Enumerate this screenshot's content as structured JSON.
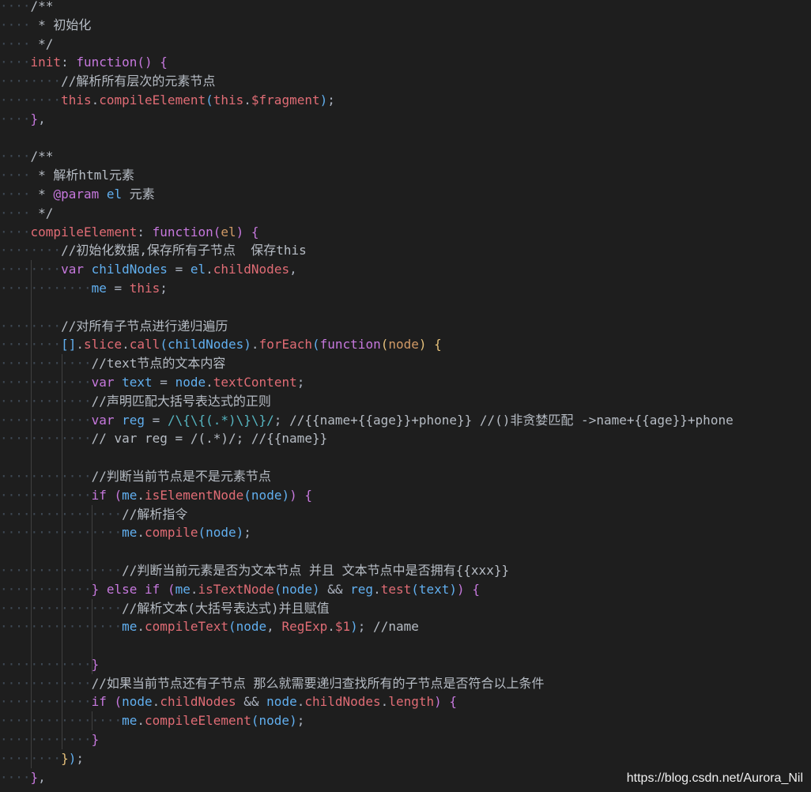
{
  "theme": {
    "background": "#1e1e1e",
    "comment": "#b6bcc4",
    "keyword": "#c678dd",
    "property": "#e06c75",
    "variable": "#61afef",
    "regex": "#56b6c2",
    "param": "#d19a66",
    "bracket_1": "#e5c07b",
    "bracket_2": "#c678dd",
    "bracket_3": "#61afef",
    "punct": "#abb2bf",
    "text": "#d7dae0",
    "indent_dots": "#3f4a56",
    "guide": "#404040"
  },
  "code_lines": [
    {
      "d": 1,
      "t": [
        [
          "/**",
          "comment"
        ]
      ]
    },
    {
      "d": 1,
      "t": [
        [
          " * 初始化",
          "comment"
        ]
      ]
    },
    {
      "d": 1,
      "t": [
        [
          " */",
          "comment"
        ]
      ]
    },
    {
      "d": 1,
      "t": [
        [
          "init",
          "property"
        ],
        [
          ": ",
          "punct"
        ],
        [
          "function",
          "keyword"
        ],
        [
          "()",
          "bracket_2"
        ],
        [
          " ",
          "text"
        ],
        [
          "{",
          "bracket_2"
        ]
      ]
    },
    {
      "d": 2,
      "t": [
        [
          "//解析所有层次的元素节点",
          "comment"
        ]
      ]
    },
    {
      "d": 2,
      "t": [
        [
          "this",
          "property"
        ],
        [
          ".",
          "punct"
        ],
        [
          "compileElement",
          "property"
        ],
        [
          "(",
          "bracket_3"
        ],
        [
          "this",
          "property"
        ],
        [
          ".",
          "punct"
        ],
        [
          "$fragment",
          "property"
        ],
        [
          ")",
          "bracket_3"
        ],
        [
          ";",
          "punct"
        ]
      ]
    },
    {
      "d": 1,
      "t": [
        [
          "}",
          "bracket_2"
        ],
        [
          ",",
          "punct"
        ]
      ]
    },
    {
      "d": 0,
      "t": []
    },
    {
      "d": 1,
      "t": [
        [
          "/**",
          "comment"
        ]
      ]
    },
    {
      "d": 1,
      "t": [
        [
          " * 解析html元素",
          "comment"
        ]
      ]
    },
    {
      "d": 1,
      "t": [
        [
          " * ",
          "comment"
        ],
        [
          "@param",
          "keyword"
        ],
        [
          " el",
          "variable"
        ],
        [
          " 元素",
          "comment"
        ]
      ]
    },
    {
      "d": 1,
      "t": [
        [
          " */",
          "comment"
        ]
      ]
    },
    {
      "d": 1,
      "t": [
        [
          "compileElement",
          "property"
        ],
        [
          ": ",
          "punct"
        ],
        [
          "function",
          "keyword"
        ],
        [
          "(",
          "bracket_2"
        ],
        [
          "el",
          "param"
        ],
        [
          ")",
          "bracket_2"
        ],
        [
          " ",
          "text"
        ],
        [
          "{",
          "bracket_2"
        ]
      ]
    },
    {
      "d": 2,
      "t": [
        [
          "//初始化数据,保存所有子节点  保存this",
          "comment"
        ]
      ]
    },
    {
      "d": 2,
      "t": [
        [
          "var",
          "keyword"
        ],
        [
          " childNodes",
          "variable"
        ],
        [
          " = ",
          "punct"
        ],
        [
          "el",
          "variable"
        ],
        [
          ".",
          "punct"
        ],
        [
          "childNodes",
          "property"
        ],
        [
          ",",
          "punct"
        ]
      ]
    },
    {
      "d": 3,
      "t": [
        [
          "me",
          "variable"
        ],
        [
          " = ",
          "punct"
        ],
        [
          "this",
          "property"
        ],
        [
          ";",
          "punct"
        ]
      ]
    },
    {
      "d": 0,
      "t": []
    },
    {
      "d": 2,
      "t": [
        [
          "//对所有子节点进行递归遍历",
          "comment"
        ]
      ]
    },
    {
      "d": 2,
      "t": [
        [
          "[]",
          "bracket_3"
        ],
        [
          ".",
          "punct"
        ],
        [
          "slice",
          "property"
        ],
        [
          ".",
          "punct"
        ],
        [
          "call",
          "property"
        ],
        [
          "(",
          "bracket_3"
        ],
        [
          "childNodes",
          "variable"
        ],
        [
          ")",
          "bracket_3"
        ],
        [
          ".",
          "punct"
        ],
        [
          "forEach",
          "property"
        ],
        [
          "(",
          "bracket_3"
        ],
        [
          "function",
          "keyword"
        ],
        [
          "(",
          "bracket_1"
        ],
        [
          "node",
          "param"
        ],
        [
          ")",
          "bracket_1"
        ],
        [
          " ",
          "text"
        ],
        [
          "{",
          "bracket_1"
        ]
      ]
    },
    {
      "d": 3,
      "t": [
        [
          "//text节点的文本内容",
          "comment"
        ]
      ]
    },
    {
      "d": 3,
      "t": [
        [
          "var",
          "keyword"
        ],
        [
          " text",
          "variable"
        ],
        [
          " = ",
          "punct"
        ],
        [
          "node",
          "variable"
        ],
        [
          ".",
          "punct"
        ],
        [
          "textContent",
          "property"
        ],
        [
          ";",
          "punct"
        ]
      ]
    },
    {
      "d": 3,
      "t": [
        [
          "//声明匹配大括号表达式的正则",
          "comment"
        ]
      ]
    },
    {
      "d": 3,
      "t": [
        [
          "var",
          "keyword"
        ],
        [
          " reg",
          "variable"
        ],
        [
          " = ",
          "punct"
        ],
        [
          "/\\{\\{(.*)\\}\\}/",
          "regex"
        ],
        [
          ";",
          "punct"
        ],
        [
          " //{{name+{{age}}+phone}} //()非贪婪匹配 ->name+{{age}}+phone",
          "comment"
        ]
      ]
    },
    {
      "d": 3,
      "t": [
        [
          "// var reg = /(.*)/; //{{name}}",
          "comment"
        ]
      ]
    },
    {
      "d": 0,
      "t": []
    },
    {
      "d": 3,
      "t": [
        [
          "//判断当前节点是不是元素节点",
          "comment"
        ]
      ]
    },
    {
      "d": 3,
      "t": [
        [
          "if",
          "keyword"
        ],
        [
          " ",
          "text"
        ],
        [
          "(",
          "bracket_2"
        ],
        [
          "me",
          "variable"
        ],
        [
          ".",
          "punct"
        ],
        [
          "isElementNode",
          "property"
        ],
        [
          "(",
          "bracket_3"
        ],
        [
          "node",
          "variable"
        ],
        [
          ")",
          "bracket_3"
        ],
        [
          ")",
          "bracket_2"
        ],
        [
          " ",
          "text"
        ],
        [
          "{",
          "bracket_2"
        ]
      ]
    },
    {
      "d": 4,
      "t": [
        [
          "//解析指令",
          "comment"
        ]
      ]
    },
    {
      "d": 4,
      "t": [
        [
          "me",
          "variable"
        ],
        [
          ".",
          "punct"
        ],
        [
          "compile",
          "property"
        ],
        [
          "(",
          "bracket_3"
        ],
        [
          "node",
          "variable"
        ],
        [
          ")",
          "bracket_3"
        ],
        [
          ";",
          "punct"
        ]
      ]
    },
    {
      "d": 0,
      "t": []
    },
    {
      "d": 4,
      "t": [
        [
          "//判断当前元素是否为文本节点 并且 文本节点中是否拥有{{xxx}}",
          "comment"
        ]
      ]
    },
    {
      "d": 3,
      "t": [
        [
          "}",
          "bracket_2"
        ],
        [
          " else if ",
          "keyword"
        ],
        [
          "(",
          "bracket_2"
        ],
        [
          "me",
          "variable"
        ],
        [
          ".",
          "punct"
        ],
        [
          "isTextNode",
          "property"
        ],
        [
          "(",
          "bracket_3"
        ],
        [
          "node",
          "variable"
        ],
        [
          ")",
          "bracket_3"
        ],
        [
          " && ",
          "punct"
        ],
        [
          "reg",
          "variable"
        ],
        [
          ".",
          "punct"
        ],
        [
          "test",
          "property"
        ],
        [
          "(",
          "bracket_3"
        ],
        [
          "text",
          "variable"
        ],
        [
          ")",
          "bracket_3"
        ],
        [
          ")",
          "bracket_2"
        ],
        [
          " ",
          "text"
        ],
        [
          "{",
          "bracket_2"
        ]
      ]
    },
    {
      "d": 4,
      "t": [
        [
          "//解析文本(大括号表达式)并且赋值",
          "comment"
        ]
      ]
    },
    {
      "d": 4,
      "t": [
        [
          "me",
          "variable"
        ],
        [
          ".",
          "punct"
        ],
        [
          "compileText",
          "property"
        ],
        [
          "(",
          "bracket_3"
        ],
        [
          "node",
          "variable"
        ],
        [
          ", ",
          "punct"
        ],
        [
          "RegExp",
          "property"
        ],
        [
          ".",
          "punct"
        ],
        [
          "$1",
          "property"
        ],
        [
          ")",
          "bracket_3"
        ],
        [
          ";",
          "punct"
        ],
        [
          " //name",
          "comment"
        ]
      ]
    },
    {
      "d": 0,
      "t": []
    },
    {
      "d": 3,
      "t": [
        [
          "}",
          "bracket_2"
        ]
      ]
    },
    {
      "d": 3,
      "t": [
        [
          "//如果当前节点还有子节点 那么就需要递归查找所有的子节点是否符合以上条件",
          "comment"
        ]
      ]
    },
    {
      "d": 3,
      "t": [
        [
          "if",
          "keyword"
        ],
        [
          " ",
          "text"
        ],
        [
          "(",
          "bracket_2"
        ],
        [
          "node",
          "variable"
        ],
        [
          ".",
          "punct"
        ],
        [
          "childNodes",
          "property"
        ],
        [
          " && ",
          "punct"
        ],
        [
          "node",
          "variable"
        ],
        [
          ".",
          "punct"
        ],
        [
          "childNodes",
          "property"
        ],
        [
          ".",
          "punct"
        ],
        [
          "length",
          "property"
        ],
        [
          ")",
          "bracket_2"
        ],
        [
          " ",
          "text"
        ],
        [
          "{",
          "bracket_2"
        ]
      ]
    },
    {
      "d": 4,
      "t": [
        [
          "me",
          "variable"
        ],
        [
          ".",
          "punct"
        ],
        [
          "compileElement",
          "property"
        ],
        [
          "(",
          "bracket_3"
        ],
        [
          "node",
          "variable"
        ],
        [
          ")",
          "bracket_3"
        ],
        [
          ";",
          "punct"
        ]
      ]
    },
    {
      "d": 3,
      "t": [
        [
          "}",
          "bracket_2"
        ]
      ]
    },
    {
      "d": 2,
      "t": [
        [
          "}",
          "bracket_1"
        ],
        [
          ")",
          "bracket_3"
        ],
        [
          ";",
          "punct"
        ]
      ]
    },
    {
      "d": 1,
      "t": [
        [
          "}",
          "bracket_2"
        ],
        [
          ",",
          "punct"
        ]
      ]
    }
  ],
  "watermark": "https://blog.csdn.net/Aurora_Nil"
}
